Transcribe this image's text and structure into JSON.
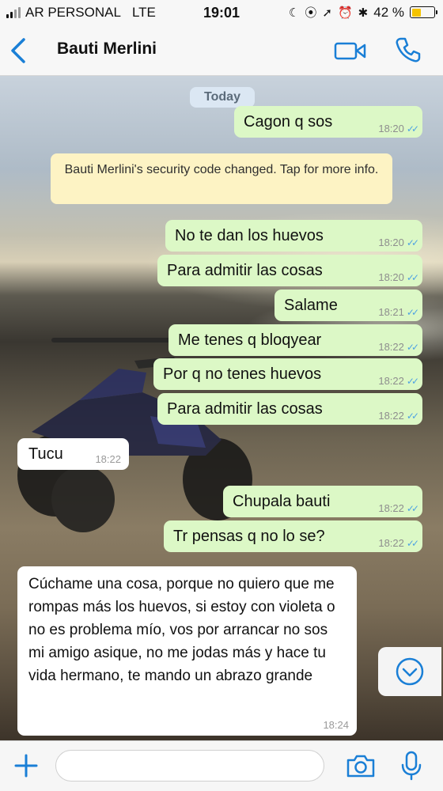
{
  "status_bar": {
    "carrier": "AR PERSONAL",
    "network": "LTE",
    "time": "19:01",
    "battery": "42 %",
    "battery_fraction": 0.42,
    "icons": [
      "signal-icon",
      "moon-icon",
      "location-icon",
      "bluetooth-icon",
      "alarm-icon",
      "battery-icon"
    ]
  },
  "header": {
    "contact_name": "Bauti Merlini",
    "icons": [
      "back-chevron-icon",
      "video-call-icon",
      "phone-icon"
    ]
  },
  "chat": {
    "day_label": "Today",
    "system_notice": "Bauti Merlini's security code changed. Tap for more info.",
    "messages": [
      {
        "direction": "out",
        "text": "Cagon q sos",
        "time": "18:20"
      },
      {
        "direction": "out",
        "text": "No te dan los huevos",
        "time": "18:20"
      },
      {
        "direction": "out",
        "text": "Para admitir las cosas",
        "time": "18:20"
      },
      {
        "direction": "out",
        "text": "Salame",
        "time": "18:21"
      },
      {
        "direction": "out",
        "text": "Me tenes q bloqyear",
        "time": "18:22"
      },
      {
        "direction": "out",
        "text": "Por q no tenes huevos",
        "time": "18:22"
      },
      {
        "direction": "out",
        "text": "Para admitir las cosas",
        "time": "18:22"
      },
      {
        "direction": "in",
        "text": "Tucu",
        "time": "18:22"
      },
      {
        "direction": "out",
        "text": "Chupala bauti",
        "time": "18:22"
      },
      {
        "direction": "out",
        "text": "Tr pensas q no lo se?",
        "time": "18:22"
      },
      {
        "direction": "in",
        "text": "Cúchame una cosa, porque no quiero que me rompas más los huevos, si estoy con violeta o no es problema mío, vos por arrancar no sos mi amigo asique, no me jodas más y hace tu vida hermano, te mando un abrazo grande",
        "time": "18:24"
      }
    ],
    "read_receipt_color": "#4fa3e2",
    "outgoing_bubble_color": "#dcf8c6",
    "incoming_bubble_color": "#ffffff",
    "scroll_button_icon": "scroll-down-chevron-icon"
  },
  "input_bar": {
    "message_placeholder": "",
    "icons": [
      "plus-icon",
      "camera-icon",
      "microphone-icon"
    ]
  },
  "accent_color": "#1a7fd6"
}
